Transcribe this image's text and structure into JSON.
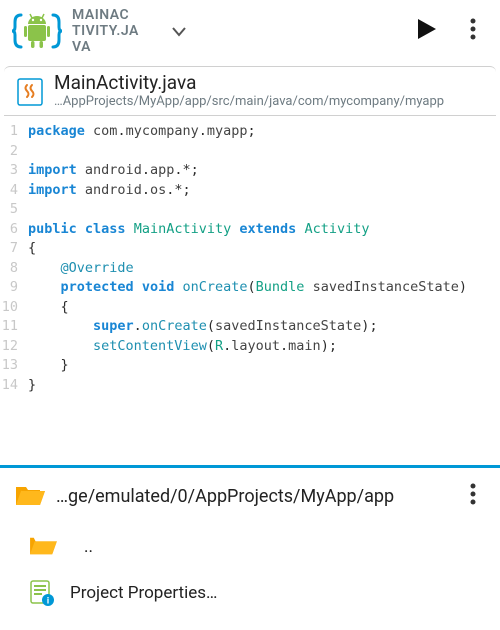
{
  "toolbar": {
    "tab_label": "MAINAC TIVITY.JA VA"
  },
  "file": {
    "name": "MainActivity.java",
    "path": "…AppProjects/MyApp/app/src/main/java/com/mycompany/myapp"
  },
  "code": {
    "lines": [
      "package com.mycompany.myapp;",
      "",
      "import android.app.*;",
      "import android.os.*;",
      "",
      "public class MainActivity extends Activity",
      "{",
      "    @Override",
      "    protected void onCreate(Bundle savedInstanceState)",
      "    {",
      "        super.onCreate(savedInstanceState);",
      "        setContentView(R.layout.main);",
      "    }",
      "}"
    ],
    "line_count": 14
  },
  "bottom": {
    "path": "…ge/emulated/0/AppProjects/MyApp/app",
    "up_label": "..",
    "properties_label": "Project Properties…"
  }
}
